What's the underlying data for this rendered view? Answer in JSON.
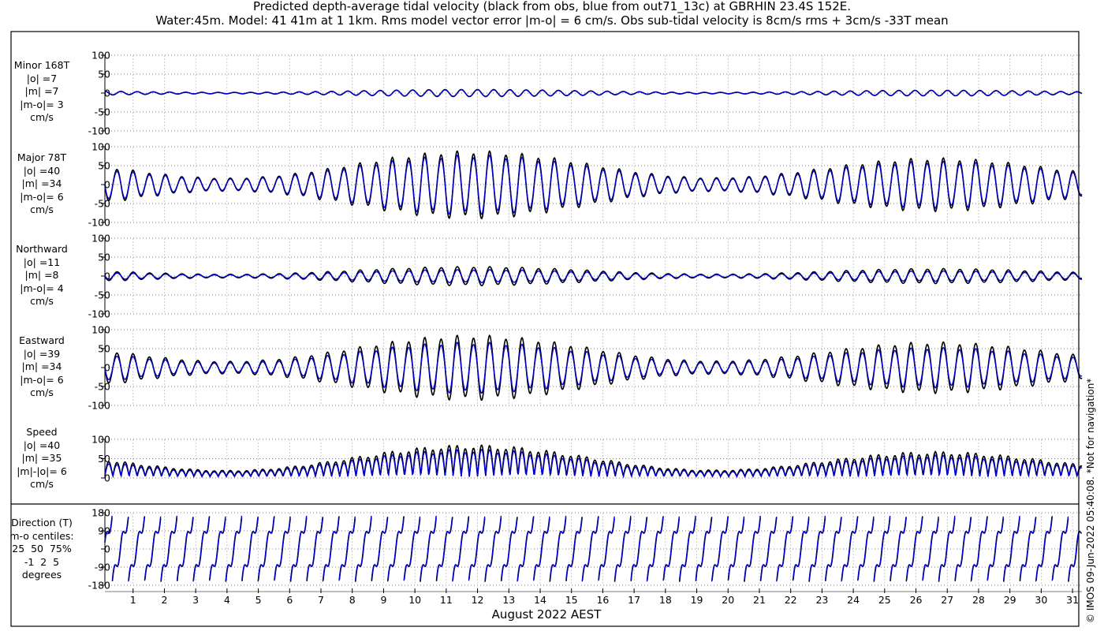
{
  "title_line1": "Predicted depth-average tidal velocity (black from obs, blue from out71_13c) at GBRHIN 23.4S 152E.",
  "title_line2": "Water:45m. Model: 41 41m at 1 1km. Rms model vector error |m-o| = 6 cm/s. Obs sub-tidal velocity is 8cm/s rms + 3cm/s -33T mean",
  "xlabel": "August 2022 AEST",
  "copyright": "© IMOS 09-Jun-2022 05:40:08. *Not for navigation*",
  "colors": {
    "obs": "#000000",
    "model": "#0000cc"
  },
  "chart_data": [
    {
      "type": "line",
      "name": "minor",
      "side_label": "Minor 168T\n|o| =7\n|m| =7\n|m-o|= 3\ncm/s",
      "ylim": [
        -100,
        100
      ],
      "yticks": [
        100,
        50,
        0,
        -50,
        -100
      ],
      "ytick_labels": [
        "100",
        "50",
        "0",
        "-50",
        "-100"
      ],
      "obs_amplitude": 7,
      "model_amplitude": 7
    },
    {
      "type": "line",
      "name": "major",
      "side_label": "Major 78T\n|o| =40\n|m| =34\n|m-o|= 6\ncm/s",
      "ylim": [
        -100,
        100
      ],
      "yticks": [
        100,
        50,
        0,
        -50,
        -100
      ],
      "ytick_labels": [
        "100",
        "50",
        "0",
        "-50",
        "-100"
      ],
      "obs_amplitude": 40,
      "model_amplitude": 34
    },
    {
      "type": "line",
      "name": "northward",
      "side_label": "Northward\n|o| =11\n|m| =8\n|m-o|= 4\ncm/s",
      "ylim": [
        -100,
        100
      ],
      "yticks": [
        100,
        50,
        0,
        -50,
        -100
      ],
      "ytick_labels": [
        "100",
        "50",
        "0",
        "-50",
        "-100"
      ],
      "obs_amplitude": 11,
      "model_amplitude": 8
    },
    {
      "type": "line",
      "name": "eastward",
      "side_label": "Eastward\n|o| =39\n|m| =34\n|m-o|= 6\ncm/s",
      "ylim": [
        -100,
        100
      ],
      "yticks": [
        100,
        50,
        0,
        -50,
        -100
      ],
      "ytick_labels": [
        "100",
        "50",
        "0",
        "-50",
        "-100"
      ],
      "obs_amplitude": 39,
      "model_amplitude": 34
    },
    {
      "type": "line",
      "name": "speed",
      "side_label": "Speed\n|o| =40\n|m| =35\n|m|-|o|= 6\ncm/s",
      "ylim": [
        0,
        100
      ],
      "yticks": [
        100,
        50,
        0
      ],
      "ytick_labels": [
        "100",
        "50",
        "0"
      ],
      "obs_amplitude": 40,
      "model_amplitude": 35
    },
    {
      "type": "line",
      "name": "direction",
      "side_label": "Direction (T)\nm-o centiles:\n25  50  75%\n-1  2  5\ndegrees",
      "ylim": [
        -180,
        180
      ],
      "yticks": [
        180,
        90,
        0,
        -90,
        -180
      ],
      "ytick_labels": [
        "180",
        "90",
        "0",
        "-90",
        "-180"
      ]
    }
  ],
  "x_axis": {
    "range_days": [
      0.1,
      31.3
    ],
    "tick_labels": [
      "1",
      "2",
      "3",
      "4",
      "5",
      "6",
      "7",
      "8",
      "9",
      "10",
      "11",
      "12",
      "13",
      "14",
      "15",
      "16",
      "17",
      "18",
      "19",
      "20",
      "21",
      "22",
      "23",
      "24",
      "25",
      "26",
      "27",
      "28",
      "29",
      "30",
      "31"
    ]
  }
}
